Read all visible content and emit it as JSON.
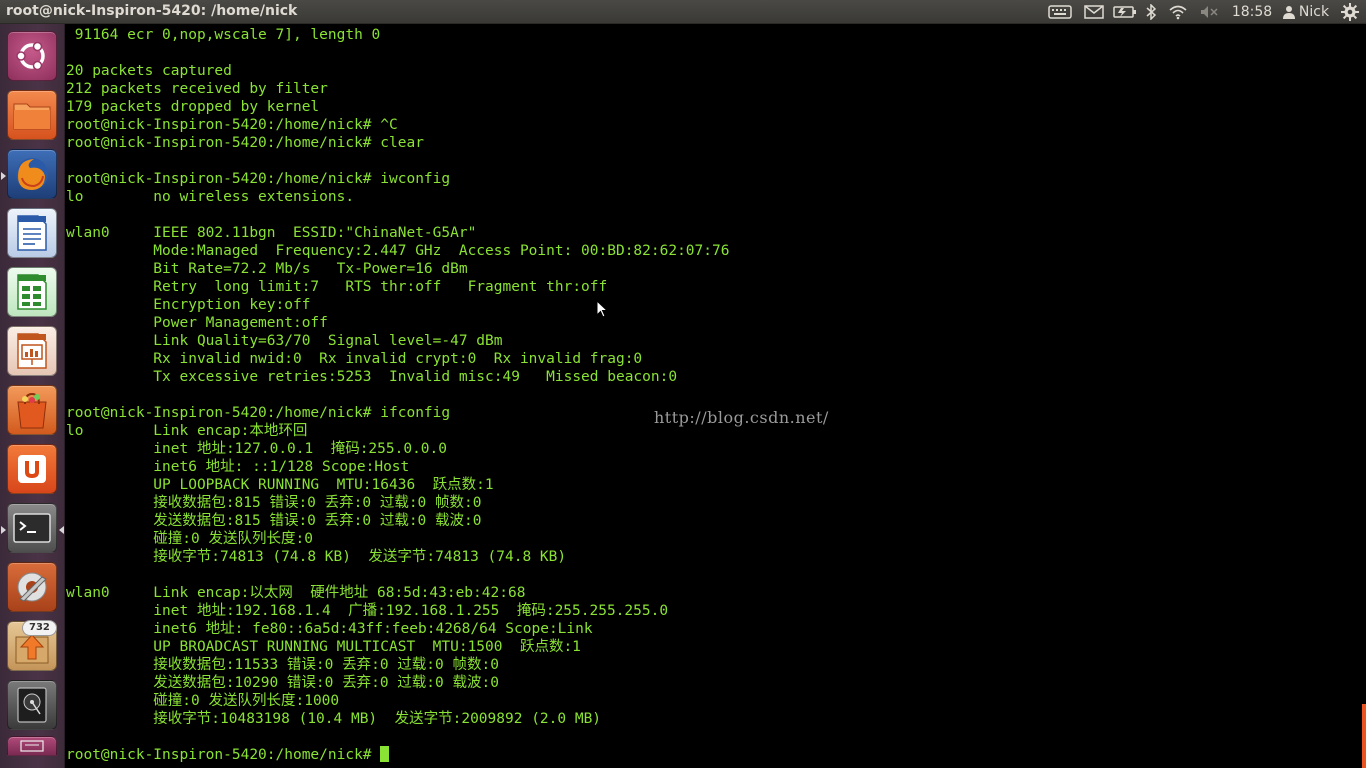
{
  "window": {
    "title": "root@nick-Inspiron-5420: /home/nick"
  },
  "panel": {
    "clock": "18:58",
    "user": "Nick"
  },
  "launcher": {
    "items": [
      {
        "name": "dash-home",
        "icon": "ubuntu-logo-icon"
      },
      {
        "name": "files",
        "icon": "folder-icon"
      },
      {
        "name": "firefox",
        "icon": "firefox-icon"
      },
      {
        "name": "libreoffice-writer",
        "icon": "writer-icon"
      },
      {
        "name": "libreoffice-calc",
        "icon": "calc-icon"
      },
      {
        "name": "libreoffice-impress",
        "icon": "impress-icon"
      },
      {
        "name": "software-center",
        "icon": "shopping-bag-icon"
      },
      {
        "name": "ubuntu-one",
        "icon": "ubuntu-one-icon"
      },
      {
        "name": "terminal",
        "icon": "terminal-icon"
      },
      {
        "name": "system-settings",
        "icon": "settings-wrench-icon"
      },
      {
        "name": "update-manager",
        "icon": "update-arrow-icon"
      },
      {
        "name": "disks",
        "icon": "disk-icon"
      }
    ],
    "update_badge": "732"
  },
  "terminal": {
    "lines": [
      " 91164 ecr 0,nop,wscale 7], length 0",
      "",
      "20 packets captured",
      "212 packets received by filter",
      "179 packets dropped by kernel",
      "root@nick-Inspiron-5420:/home/nick# ^C",
      "root@nick-Inspiron-5420:/home/nick# clear",
      "",
      "root@nick-Inspiron-5420:/home/nick# iwconfig",
      "lo        no wireless extensions.",
      "",
      "wlan0     IEEE 802.11bgn  ESSID:\"ChinaNet-G5Ar\"",
      "          Mode:Managed  Frequency:2.447 GHz  Access Point: 00:BD:82:62:07:76",
      "          Bit Rate=72.2 Mb/s   Tx-Power=16 dBm",
      "          Retry  long limit:7   RTS thr:off   Fragment thr:off",
      "          Encryption key:off",
      "          Power Management:off",
      "          Link Quality=63/70  Signal level=-47 dBm",
      "          Rx invalid nwid:0  Rx invalid crypt:0  Rx invalid frag:0",
      "          Tx excessive retries:5253  Invalid misc:49   Missed beacon:0",
      "",
      "root@nick-Inspiron-5420:/home/nick# ifconfig",
      "lo        Link encap:本地环回",
      "          inet 地址:127.0.0.1  掩码:255.0.0.0",
      "          inet6 地址: ::1/128 Scope:Host",
      "          UP LOOPBACK RUNNING  MTU:16436  跃点数:1",
      "          接收数据包:815 错误:0 丢弃:0 过载:0 帧数:0",
      "          发送数据包:815 错误:0 丢弃:0 过载:0 载波:0",
      "          碰撞:0 发送队列长度:0",
      "          接收字节:74813 (74.8 KB)  发送字节:74813 (74.8 KB)",
      "",
      "wlan0     Link encap:以太网  硬件地址 68:5d:43:eb:42:68",
      "          inet 地址:192.168.1.4  广播:192.168.1.255  掩码:255.255.255.0",
      "          inet6 地址: fe80::6a5d:43ff:feeb:4268/64 Scope:Link",
      "          UP BROADCAST RUNNING MULTICAST  MTU:1500  跃点数:1",
      "          接收数据包:11533 错误:0 丢弃:0 过载:0 帧数:0",
      "          发送数据包:10290 错误:0 丢弃:0 过载:0 载波:0",
      "          碰撞:0 发送队列长度:1000",
      "          接收字节:10483198 (10.4 MB)  发送字节:2009892 (2.0 MB)",
      ""
    ],
    "prompt": "root@nick-Inspiron-5420:/home/nick# "
  },
  "watermark": "http://blog.csdn.net/",
  "colors": {
    "terminal_text": "#8ae234",
    "terminal_bg": "#000000",
    "panel_bg": "#3c3b37"
  }
}
